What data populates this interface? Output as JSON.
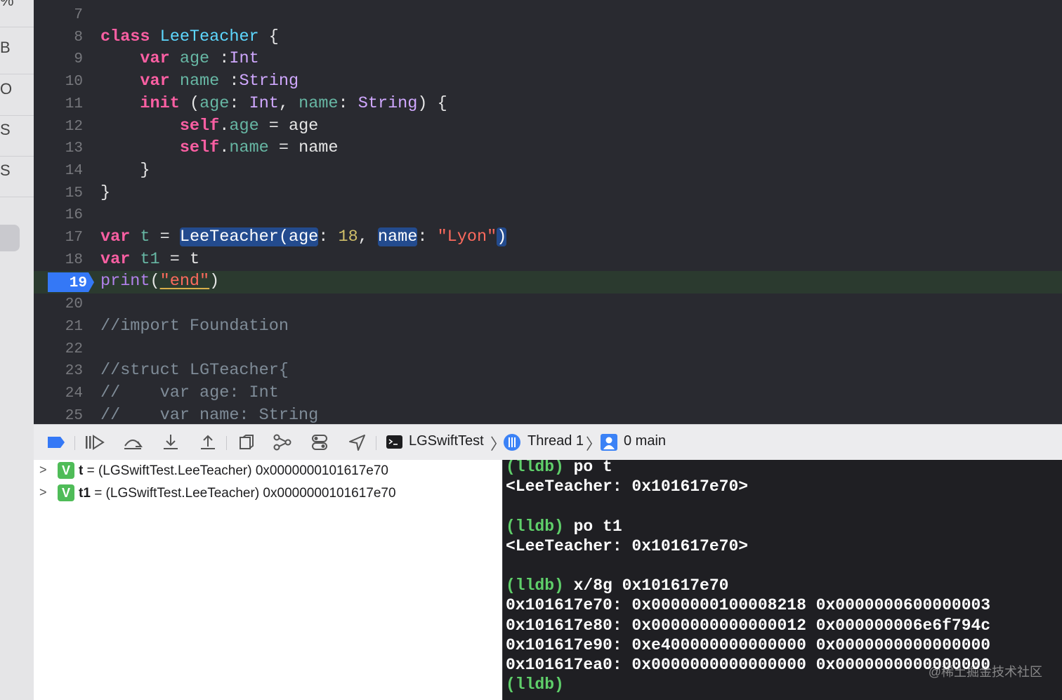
{
  "sidebar": {
    "glyphs": [
      "%",
      "B",
      "O",
      "S",
      "S"
    ]
  },
  "editor": {
    "lines": [
      {
        "num": "7",
        "tokens": []
      },
      {
        "num": "8",
        "tokens": [
          {
            "t": "class",
            "c": "kw"
          },
          {
            "t": " "
          },
          {
            "t": "LeeTeacher",
            "c": "cls"
          },
          {
            "t": " {"
          }
        ]
      },
      {
        "num": "9",
        "tokens": [
          {
            "t": "    "
          },
          {
            "t": "var",
            "c": "kw"
          },
          {
            "t": " "
          },
          {
            "t": "age",
            "c": "prop"
          },
          {
            "t": " :"
          },
          {
            "t": "Int",
            "c": "typ"
          }
        ]
      },
      {
        "num": "10",
        "tokens": [
          {
            "t": "    "
          },
          {
            "t": "var",
            "c": "kw"
          },
          {
            "t": " "
          },
          {
            "t": "name",
            "c": "prop"
          },
          {
            "t": " :"
          },
          {
            "t": "String",
            "c": "typ"
          }
        ]
      },
      {
        "num": "11",
        "tokens": [
          {
            "t": "    "
          },
          {
            "t": "init",
            "c": "kw"
          },
          {
            "t": " ("
          },
          {
            "t": "age",
            "c": "prop"
          },
          {
            "t": ": "
          },
          {
            "t": "Int",
            "c": "typ"
          },
          {
            "t": ", "
          },
          {
            "t": "name",
            "c": "prop"
          },
          {
            "t": ": "
          },
          {
            "t": "String",
            "c": "typ"
          },
          {
            "t": ") {"
          }
        ]
      },
      {
        "num": "12",
        "tokens": [
          {
            "t": "        "
          },
          {
            "t": "self",
            "c": "kw"
          },
          {
            "t": "."
          },
          {
            "t": "age",
            "c": "prop"
          },
          {
            "t": " = age"
          }
        ]
      },
      {
        "num": "13",
        "tokens": [
          {
            "t": "        "
          },
          {
            "t": "self",
            "c": "kw"
          },
          {
            "t": "."
          },
          {
            "t": "name",
            "c": "prop"
          },
          {
            "t": " = name"
          }
        ]
      },
      {
        "num": "14",
        "tokens": [
          {
            "t": "    }"
          }
        ]
      },
      {
        "num": "15",
        "tokens": [
          {
            "t": "}"
          }
        ]
      },
      {
        "num": "16",
        "tokens": []
      },
      {
        "num": "17",
        "tokens": [
          {
            "t": "var",
            "c": "kw"
          },
          {
            "t": " "
          },
          {
            "t": "t",
            "c": "prop"
          },
          {
            "t": " = "
          },
          {
            "t": "LeeTeacher(age",
            "c": "sel"
          },
          {
            "t": ": "
          },
          {
            "t": "18",
            "c": "num"
          },
          {
            "t": ", "
          },
          {
            "t": "name",
            "c": "sel"
          },
          {
            "t": ": "
          },
          {
            "t": "\"Lyon\"",
            "c": "str"
          },
          {
            "t": ")",
            "c": "sel"
          }
        ]
      },
      {
        "num": "18",
        "tokens": [
          {
            "t": "var",
            "c": "kw"
          },
          {
            "t": " "
          },
          {
            "t": "t1",
            "c": "prop"
          },
          {
            "t": " = t"
          }
        ]
      },
      {
        "num": "19",
        "tokens": [
          {
            "t": "print",
            "c": "fn"
          },
          {
            "t": "("
          },
          {
            "t": "\"end\"",
            "c": "str under"
          },
          {
            "t": ")"
          }
        ],
        "current": true
      },
      {
        "num": "20",
        "tokens": []
      },
      {
        "num": "21",
        "tokens": [
          {
            "t": "//import Foundation",
            "c": "cmt"
          }
        ]
      },
      {
        "num": "22",
        "tokens": []
      },
      {
        "num": "23",
        "tokens": [
          {
            "t": "//struct LGTeacher{",
            "c": "cmt"
          }
        ]
      },
      {
        "num": "24",
        "tokens": [
          {
            "t": "//    var age: Int",
            "c": "cmt"
          }
        ]
      },
      {
        "num": "25",
        "tokens": [
          {
            "t": "//    var name: String",
            "c": "cmt"
          }
        ]
      }
    ]
  },
  "debugbar": {
    "target": "LGSwiftTest",
    "thread": "Thread 1",
    "frame": "0 main"
  },
  "variables": [
    {
      "name": "t",
      "value": "= (LGSwiftTest.LeeTeacher) 0x0000000101617e70",
      "badge": "V"
    },
    {
      "name": "t1",
      "value": "= (LGSwiftTest.LeeTeacher) 0x0000000101617e70",
      "badge": "V"
    }
  ],
  "console": {
    "lines": [
      {
        "prompt": "(lldb)",
        "text": " po t"
      },
      {
        "prompt": "",
        "text": "<LeeTeacher: 0x101617e70>"
      },
      {
        "prompt": "",
        "text": ""
      },
      {
        "prompt": "(lldb)",
        "text": " po t1"
      },
      {
        "prompt": "",
        "text": "<LeeTeacher: 0x101617e70>"
      },
      {
        "prompt": "",
        "text": ""
      },
      {
        "prompt": "(lldb)",
        "text": " x/8g 0x101617e70"
      },
      {
        "prompt": "",
        "text": "0x101617e70: 0x0000000100008218 0x0000000600000003"
      },
      {
        "prompt": "",
        "text": "0x101617e80: 0x0000000000000012 0x000000006e6f794c"
      },
      {
        "prompt": "",
        "text": "0x101617e90: 0xe400000000000000 0x0000000000000000"
      },
      {
        "prompt": "",
        "text": "0x101617ea0: 0x0000000000000000 0x0000000000000000"
      },
      {
        "prompt": "(lldb)",
        "text": ""
      }
    ],
    "watermark": "@稀土掘金技术社区"
  }
}
